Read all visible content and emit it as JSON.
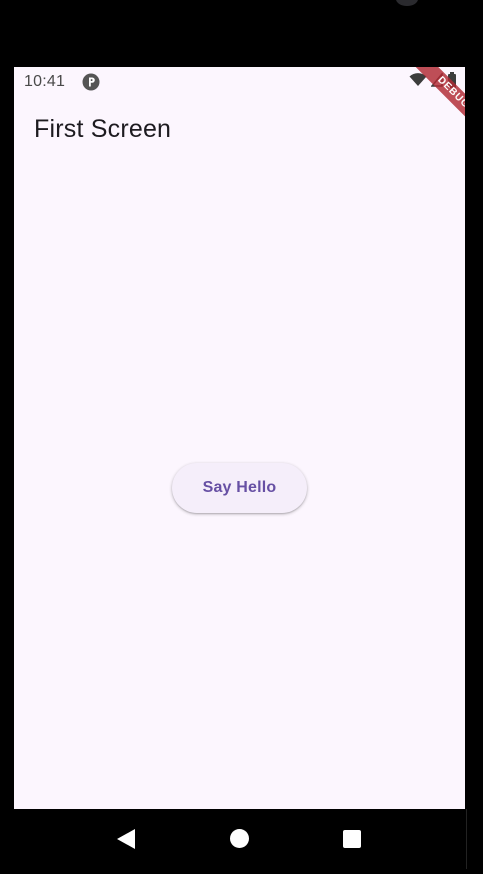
{
  "status_bar": {
    "time": "10:41",
    "icons": [
      "app-status-icon",
      "wifi-icon",
      "signal-icon",
      "battery-icon"
    ]
  },
  "app_bar": {
    "title": "First Screen"
  },
  "main": {
    "say_hello_label": "Say Hello"
  },
  "debug_banner": {
    "label": "DEBUG"
  },
  "nav_bar": {
    "icons": [
      "back-icon",
      "home-icon",
      "recents-icon"
    ]
  },
  "colors": {
    "background": "#fcf6fe",
    "primary": "#6750a4",
    "button_bg": "#f5eefa",
    "debug_banner": "#b02832"
  }
}
